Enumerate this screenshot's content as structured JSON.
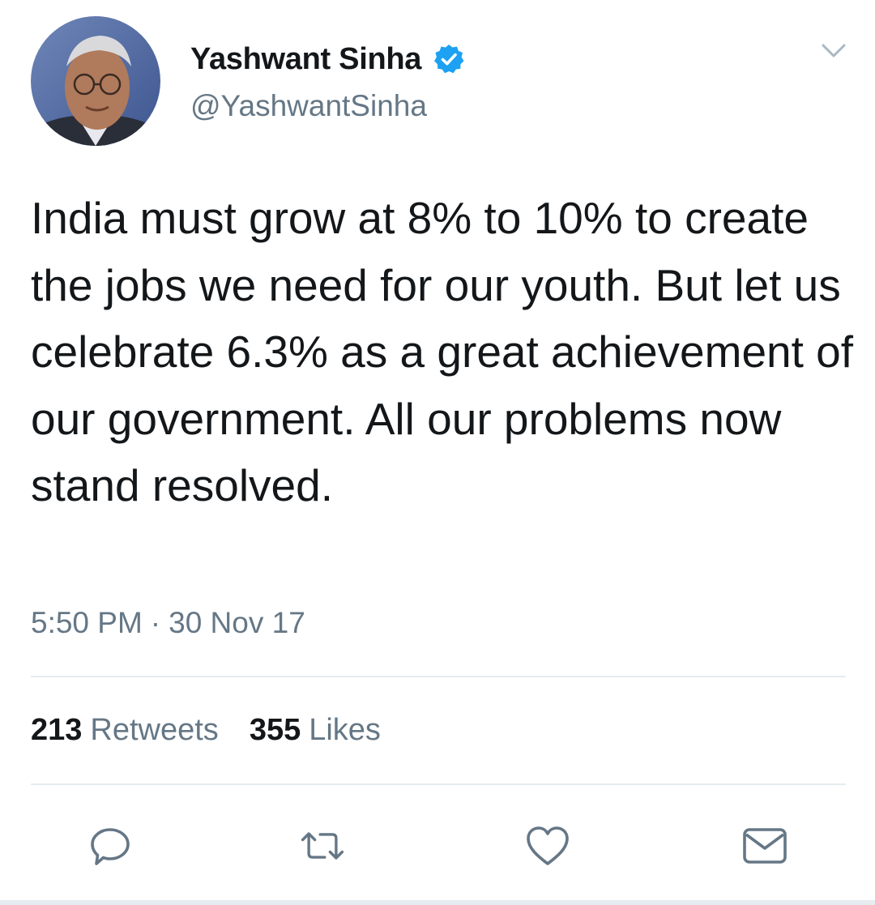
{
  "author": {
    "name": "Yashwant Sinha",
    "handle": "@YashwantSinha",
    "verified": true
  },
  "tweet": {
    "text": "India must grow at 8% to 10% to create the jobs we need for our youth. But let us celebrate 6.3% as a great achievement of our government. All our problems now stand resolved.",
    "time": "5:50 PM",
    "separator": "·",
    "date": "30 Nov 17"
  },
  "stats": {
    "retweets_count": "213",
    "retweets_label": "Retweets",
    "likes_count": "355",
    "likes_label": "Likes"
  },
  "actions": [
    {
      "name": "reply",
      "icon": "reply-icon"
    },
    {
      "name": "retweet",
      "icon": "retweet-icon"
    },
    {
      "name": "like",
      "icon": "heart-icon"
    },
    {
      "name": "direct-message",
      "icon": "mail-icon"
    }
  ],
  "colors": {
    "text_primary": "#14171a",
    "text_secondary": "#657786",
    "verified_blue": "#1da1f2",
    "divider": "#e6ecf0"
  }
}
